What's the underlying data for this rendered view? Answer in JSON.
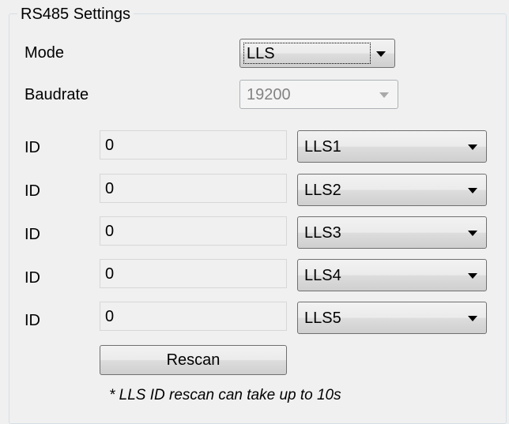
{
  "group": {
    "title": "RS485 Settings"
  },
  "mode": {
    "label": "Mode",
    "value": "LLS"
  },
  "baudrate": {
    "label": "Baudrate",
    "value": "19200"
  },
  "id_rows": [
    {
      "label": "ID",
      "value": "0",
      "sensor": "LLS1"
    },
    {
      "label": "ID",
      "value": "0",
      "sensor": "LLS2"
    },
    {
      "label": "ID",
      "value": "0",
      "sensor": "LLS3"
    },
    {
      "label": "ID",
      "value": "0",
      "sensor": "LLS4"
    },
    {
      "label": "ID",
      "value": "0",
      "sensor": "LLS5"
    }
  ],
  "rescan_button": {
    "label": "Rescan"
  },
  "note": "* LLS ID rescan can take up to 10s"
}
